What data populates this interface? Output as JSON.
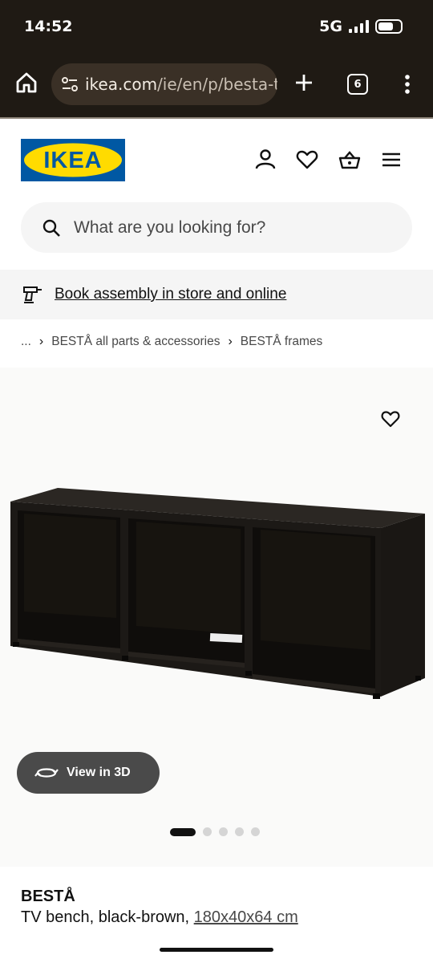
{
  "status_bar": {
    "time": "14:52",
    "network": "5G"
  },
  "browser": {
    "url_host": "ikea.com",
    "url_path": "/ie/en/p/besta-t",
    "tab_count": "6"
  },
  "header": {
    "logo_text": "IKEA",
    "icons": [
      "account-icon",
      "heart-icon",
      "basket-icon",
      "hamburger-menu-icon"
    ]
  },
  "search": {
    "placeholder": "What are you looking for?"
  },
  "banner": {
    "link_text": "Book assembly in store and online"
  },
  "breadcrumb": {
    "ellipsis": "...",
    "items": [
      "BESTÅ all parts & accessories",
      "BESTÅ frames"
    ]
  },
  "gallery": {
    "view3d_label": "View in 3D",
    "image_count": 5,
    "active_index": 0
  },
  "product": {
    "name": "BESTÅ",
    "description": "TV bench, black-brown, ",
    "size": "180x40x64 cm"
  },
  "colors": {
    "browser_bg": "#1f1a14",
    "ikea_blue": "#0058a3",
    "ikea_yellow": "#ffdb00",
    "product_black_brown": "#1c1916"
  }
}
